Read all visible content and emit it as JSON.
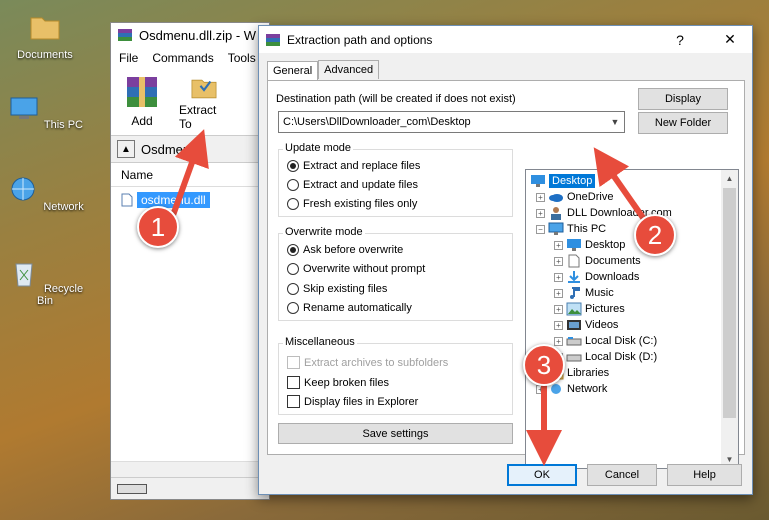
{
  "desktop": {
    "icons": [
      {
        "label": "Documents",
        "icon": "folder-icon"
      },
      {
        "label": "This PC",
        "icon": "computer-icon"
      },
      {
        "label": "Network",
        "icon": "network-icon"
      },
      {
        "label": "Recycle Bin",
        "icon": "recycle-bin-icon"
      }
    ]
  },
  "winrar": {
    "title": "Osdmenu.dll.zip - W",
    "menu": [
      "File",
      "Commands",
      "Tools"
    ],
    "toolbar": {
      "add": "Add",
      "extract_to": "Extract To"
    },
    "address": "Osdmenu.",
    "column_name": "Name",
    "file": "osdmenu.dll"
  },
  "dialog": {
    "title": "Extraction path and options",
    "help_glyph": "?",
    "close_glyph": "✕",
    "tabs": [
      "General",
      "Advanced"
    ],
    "dest_label": "Destination path (will be created if does not exist)",
    "dest_value": "C:\\Users\\DllDownloader_com\\Desktop",
    "display_btn": "Display",
    "new_folder_btn": "New Folder",
    "update_mode": {
      "title": "Update mode",
      "options": [
        "Extract and replace files",
        "Extract and update files",
        "Fresh existing files only"
      ],
      "selected": 0
    },
    "overwrite_mode": {
      "title": "Overwrite mode",
      "options": [
        "Ask before overwrite",
        "Overwrite without prompt",
        "Skip existing files",
        "Rename automatically"
      ],
      "selected": 0
    },
    "misc": {
      "title": "Miscellaneous",
      "options": [
        "Extract archives to subfolders",
        "Keep broken files",
        "Display files in Explorer"
      ]
    },
    "save_settings": "Save settings",
    "tree": [
      {
        "label": "Desktop",
        "icon": "desktop-icon"
      },
      {
        "label": "OneDrive",
        "icon": "onedrive-icon"
      },
      {
        "label": "DLL Downloader.com",
        "icon": "user-icon"
      },
      {
        "label": "This PC",
        "icon": "computer-icon"
      },
      {
        "label": "Desktop",
        "icon": "desktop-icon"
      },
      {
        "label": "Documents",
        "icon": "documents-icon"
      },
      {
        "label": "Downloads",
        "icon": "downloads-icon"
      },
      {
        "label": "Music",
        "icon": "music-icon"
      },
      {
        "label": "Pictures",
        "icon": "pictures-icon"
      },
      {
        "label": "Videos",
        "icon": "videos-icon"
      },
      {
        "label": "Local Disk (C:)",
        "icon": "drive-icon"
      },
      {
        "label": "Local Disk (D:)",
        "icon": "drive-icon"
      },
      {
        "label": "Libraries",
        "icon": "folder-icon"
      },
      {
        "label": "Network",
        "icon": "network-icon"
      }
    ],
    "buttons": {
      "ok": "OK",
      "cancel": "Cancel",
      "help": "Help"
    }
  },
  "annotations": {
    "step1": "1",
    "step2": "2",
    "step3": "3"
  },
  "colors": {
    "accent": "#0078d7",
    "marker": "#e74c3c"
  }
}
